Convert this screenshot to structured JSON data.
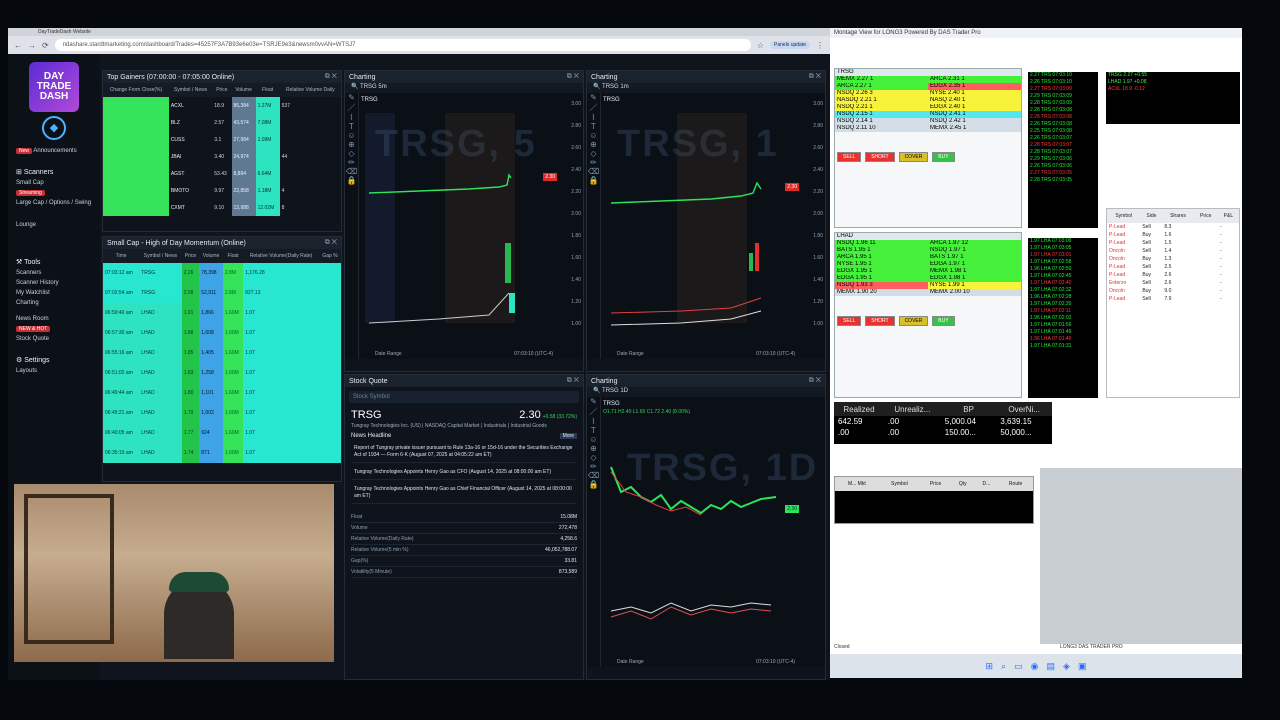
{
  "browser": {
    "url": "ndashare.stardtmarketing.com/dashboard/Trades=45257F3A7B93e6e03e=TSRJE9e3&newsm0vvAN=WTSJ7",
    "tab_title": "DayTradeDash Website",
    "ext_label": "Panels update"
  },
  "sidebar": {
    "logo_text": "DAY TRADE DASH",
    "announcements": "Announcements",
    "scanners_title": "Scanners",
    "items": [
      "Small Cap",
      "Large Cap / Options / Swing",
      "Lounge"
    ],
    "small_cap_badge": "Streaming",
    "tools_title": "Tools",
    "tools": [
      "Scanners",
      "Scanner History",
      "My Watchlist",
      "Charting",
      "News Room",
      "Stock Quote"
    ],
    "news_badge": "NEW & HOT",
    "settings": "Settings",
    "layouts": "Layouts"
  },
  "top_gainers": {
    "title": "Top Gainers (07:00:00 - 07:05:00 Online)",
    "headers": [
      "Change From Close(%)",
      "Symbol / News",
      "Price",
      "Volume",
      "Float",
      "Relative Volume Daily"
    ],
    "rows": [
      {
        "sym": "ACXL",
        "price": "18.9",
        "vol": "86,384",
        "float": "1.27M",
        "rel": "537"
      },
      {
        "sym": "BLZ",
        "price": "2.57",
        "vol": "43,574",
        "float": "7.08M",
        "rel": ""
      },
      {
        "sym": "CUSS",
        "price": "3.1",
        "vol": "27,984",
        "float": "1.09M",
        "rel": ""
      },
      {
        "sym": "JBAI",
        "price": "3.40",
        "vol": "24,974",
        "float": "",
        "rel": "44"
      },
      {
        "sym": "AGST",
        "price": "53.43",
        "vol": "8,894",
        "float": "6.64M",
        "rel": ""
      },
      {
        "sym": "BMOTO",
        "price": "9.97",
        "vol": "22,858",
        "float": "1.18M",
        "rel": "4"
      },
      {
        "sym": "CXMT",
        "price": "9.10",
        "vol": "13,988",
        "float": "12.02M",
        "rel": "8"
      }
    ]
  },
  "hod": {
    "title": "Small Cap - High of Day Momentum (Online)",
    "headers": [
      "Time",
      "Symbol / News",
      "Price",
      "Volume",
      "Float",
      "Relative Volume(Daily Rate)",
      "Gap %"
    ],
    "rows": [
      {
        "t": "07:03:12 am",
        "sym": "TRSG",
        "price": "2.26",
        "vol": "78,398",
        "float": "2.8M",
        "rel": "1,176.28"
      },
      {
        "t": "07:02:54 am",
        "sym": "TRSG",
        "price": "2.09",
        "vol": "52,911",
        "float": "2.8M",
        "rel": "827.13"
      },
      {
        "t": "06:59:40 am",
        "sym": "LHAD",
        "price": "1.91",
        "vol": "1,866",
        "float": "1.60M",
        "rel": "1.07"
      },
      {
        "t": "06:57:30 am",
        "sym": "LHAD",
        "price": "1.88",
        "vol": "1,608",
        "float": "1.60M",
        "rel": "1.07"
      },
      {
        "t": "06:55:16 am",
        "sym": "LHAD",
        "price": "1.85",
        "vol": "1,405",
        "float": "1.60M",
        "rel": "1.07"
      },
      {
        "t": "06:51:02 am",
        "sym": "LHAD",
        "price": "1.83",
        "vol": "1,258",
        "float": "1.60M",
        "rel": "1.07"
      },
      {
        "t": "06:49:44 am",
        "sym": "LHAD",
        "price": "1.80",
        "vol": "1,101",
        "float": "1.60M",
        "rel": "1.07"
      },
      {
        "t": "06:45:21 am",
        "sym": "LHAD",
        "price": "1.79",
        "vol": "1,002",
        "float": "1.60M",
        "rel": "1.07"
      },
      {
        "t": "06:40:05 am",
        "sym": "LHAD",
        "price": "1.77",
        "vol": "924",
        "float": "1.60M",
        "rel": "1.07"
      },
      {
        "t": "06:35:19 am",
        "sym": "LHAD",
        "price": "1.74",
        "vol": "871",
        "float": "1.60M",
        "rel": "1.07"
      }
    ]
  },
  "chart1": {
    "title": "Charting",
    "symbol": "TRSG",
    "watermark": "TRSG, 5",
    "interval": "5m",
    "range_label": "Date Range",
    "time": "07:03:10 (UTC-4)",
    "price_tag": "2.30",
    "prices": [
      "3.00",
      "2.80",
      "2.60",
      "2.40",
      "2.20",
      "2.00",
      "1.80",
      "1.60",
      "1.40",
      "1.20",
      "1.00"
    ]
  },
  "chart2": {
    "title": "Charting",
    "symbol": "TRSG",
    "watermark": "TRSG, 1",
    "interval": "1m",
    "range_label": "Date Range",
    "time": "07:03:10 (UTC-4)",
    "price_tag": "2.30",
    "prices": [
      "3.00",
      "2.80",
      "2.60",
      "2.40",
      "2.20",
      "2.00",
      "1.80",
      "1.60",
      "1.40",
      "1.20",
      "1.00"
    ]
  },
  "chart3": {
    "title": "Charting",
    "symbol": "TRSG",
    "watermark": "TRSG, 1D",
    "interval": "1D",
    "range_label": "Date Range",
    "time": "07:03:10 (UTC-4)",
    "price_tag": "2.30",
    "ohlc": "O1.71 H2.40 L1.65 C1.72 2.40 (8.00%)"
  },
  "quote": {
    "title": "Stock Quote",
    "search_placeholder": "Stock Symbol",
    "symbol": "TRSG",
    "price": "2.30",
    "change": "+0.58 (33.72%)",
    "company": "Tungray Technologies Inc. (US) | NASDAQ Capital Market | Industrials | Industrial Goods",
    "news_title": "News Headline",
    "news_badge": "More",
    "news": [
      "Report of Tungray private issuer pursuant to Rule 13a-16 or 15d-16 under the Securities Exchange Act of 1934 — Form 6-K (August 07, 2025 at 04:05:22 am ET)",
      "Tungray Technologies Appoints Henry Gao as CFO (August 14, 2025 at 08:00:00 am ET)",
      "Tungray Technologies Appoints Henry Gao as Chief Financial Officer (August 14, 2025 at 08:00:00 am ET)"
    ],
    "stats": [
      {
        "k": "Float",
        "v": "15.08M"
      },
      {
        "k": "Volume",
        "v": "272,478"
      },
      {
        "k": "Relative Volume(Daily Rate)",
        "v": "4,258.6"
      },
      {
        "k": "Relative Volume(5 min %)",
        "v": "46,052,788.07"
      },
      {
        "k": "Gap(%)",
        "v": "33.81"
      },
      {
        "k": "Volatility(5 Minute)",
        "v": "873,589"
      }
    ]
  },
  "level2_a": {
    "title": "Montage View for LONG3 Powered By DAS Trader Pro",
    "symbol": "TRSG",
    "bid_rows": [
      {
        "mm": "MEMX",
        "p": "2.27",
        "s": "1",
        "c": "g"
      },
      {
        "mm": "ARCA",
        "p": "2.27",
        "s": "1",
        "c": "g"
      },
      {
        "mm": "NSDQ",
        "p": "2.26",
        "s": "3",
        "c": "y"
      },
      {
        "mm": "NASDQ",
        "p": "2.21",
        "s": "1",
        "c": "y"
      },
      {
        "mm": "NSDQ",
        "p": "2.21",
        "s": "1",
        "c": "y"
      },
      {
        "mm": "NSDQ",
        "p": "2.15",
        "s": "1",
        "c": "c"
      },
      {
        "mm": "NSDQ",
        "p": "2.14",
        "s": "1",
        "c": "s"
      },
      {
        "mm": "NSDQ",
        "p": "2.11",
        "s": "10",
        "c": "s"
      }
    ],
    "ask_rows": [
      {
        "mm": "ARCA",
        "p": "2.31",
        "s": "1",
        "c": "g"
      },
      {
        "mm": "EDGX",
        "p": "2.35",
        "s": "1",
        "c": "r"
      },
      {
        "mm": "NYSE",
        "p": "2.40",
        "s": "1",
        "c": "y"
      },
      {
        "mm": "NASQ",
        "p": "2.40",
        "s": "1",
        "c": "y"
      },
      {
        "mm": "EDGX",
        "p": "2.40",
        "s": "1",
        "c": "y"
      },
      {
        "mm": "NSDQ",
        "p": "2.41",
        "s": "1",
        "c": "c"
      },
      {
        "mm": "NSDQ",
        "p": "2.42",
        "s": "1",
        "c": "s"
      },
      {
        "mm": "MEMX",
        "p": "2.45",
        "s": "1",
        "c": "s"
      }
    ]
  },
  "level2_b": {
    "symbol": "LHAD",
    "bid_rows": [
      {
        "mm": "NSDQ",
        "p": "1.96",
        "s": "11",
        "c": "g"
      },
      {
        "mm": "BATS",
        "p": "1.95",
        "s": "1",
        "c": "g"
      },
      {
        "mm": "ARCA",
        "p": "1.95",
        "s": "1",
        "c": "g"
      },
      {
        "mm": "NYSE",
        "p": "1.95",
        "s": "1",
        "c": "g"
      },
      {
        "mm": "EDGX",
        "p": "1.95",
        "s": "1",
        "c": "g"
      },
      {
        "mm": "EDGA",
        "p": "1.95",
        "s": "1",
        "c": "g"
      },
      {
        "mm": "NSDQ",
        "p": "1.93",
        "s": "3",
        "c": "r"
      },
      {
        "mm": "MEMX",
        "p": "1.90",
        "s": "20",
        "c": "s"
      }
    ],
    "ask_rows": [
      {
        "mm": "ARCA",
        "p": "1.97",
        "s": "12",
        "c": "g"
      },
      {
        "mm": "NSDQ",
        "p": "1.97",
        "s": "1",
        "c": "g"
      },
      {
        "mm": "BATS",
        "p": "1.97",
        "s": "1",
        "c": "g"
      },
      {
        "mm": "EDGA",
        "p": "1.97",
        "s": "1",
        "c": "g"
      },
      {
        "mm": "MEMX",
        "p": "1.98",
        "s": "1",
        "c": "g"
      },
      {
        "mm": "EDGX",
        "p": "1.98",
        "s": "1",
        "c": "g"
      },
      {
        "mm": "NYSE",
        "p": "1.99",
        "s": "1",
        "c": "y"
      },
      {
        "mm": "MEMX",
        "p": "2.00",
        "s": "10",
        "c": "s"
      }
    ]
  },
  "buttons": {
    "sell": "SELL",
    "short": "SHORT",
    "buy": "BUY",
    "cover": "COVER"
  },
  "timesales_a": [
    "2.27 TRS 07:03:10",
    "2.26 TRS 07:03:10",
    "2.27 TRS 07:03:09",
    "2.29 TRS 07:03:09",
    "2.28 TRS 07:03:09",
    "2.28 TRS 07:03:08",
    "2.28 TRS 07:03:08",
    "2.26 TRS 07:03:08",
    "2.25 TRS 07:03:08",
    "2.26 TRS 07:03:07",
    "2.28 TRS 07:03:07",
    "2.28 TRS 07:03:07",
    "2.29 TRS 07:03:06",
    "2.26 TRS 07:03:06",
    "2.27 TRS 07:03:05",
    "2.28 TRS 07:03:05"
  ],
  "timesales_b": [
    "1.97 LHA 07:03:09",
    "1.97 LHA 07:03:05",
    "1.97 LHA 07:03:01",
    "1.97 LHA 07:02:58",
    "1.96 LHA 07:02:50",
    "1.97 LHA 07:02:45",
    "1.97 LHA 07:02:40",
    "1.97 LHA 07:02:32",
    "1.96 LHA 07:02:28",
    "1.97 LHA 07:02:20",
    "1.97 LHA 07:02:11",
    "1.96 LHA 07:02:02",
    "1.97 LHA 07:01:56",
    "1.97 LHA 07:01:49",
    "1.96 LHA 07:01:40",
    "1.97 LHA 07:01:31"
  ],
  "positions": {
    "headers": [
      "Symbol",
      "Side",
      "Shares",
      "Price",
      "P&L"
    ],
    "rows": [
      [
        "P-Lead",
        "Sell",
        "8.3",
        "",
        "-"
      ],
      [
        "P-Lead",
        "Buy",
        "1.6",
        "",
        "-"
      ],
      [
        "P-Lead",
        "Sell",
        "1.5",
        "",
        "-"
      ],
      [
        "Oncoln",
        "Sell",
        "1.4",
        "",
        "-"
      ],
      [
        "Oncoln",
        "Buy",
        "1.3",
        "",
        "-"
      ],
      [
        "P-Lead",
        "Sell",
        "2.5",
        "",
        "-"
      ],
      [
        "P-Lead",
        "Buy",
        "2.6",
        "",
        "-"
      ],
      [
        "Enterzo",
        "Sell",
        "2.6",
        "",
        "-"
      ],
      [
        "Oncoln",
        "Buy",
        "9.0",
        "",
        "-"
      ],
      [
        "P-Lead",
        "Sell",
        "7.9",
        "",
        "-"
      ]
    ]
  },
  "account": {
    "headers": [
      "Realized",
      "Unrealiz...",
      "BP",
      "OverNi..."
    ],
    "rows": [
      [
        "642.59",
        ".00",
        "5,000.04",
        "3,639.15"
      ],
      [
        ".00",
        ".00",
        "150.00...",
        "50,000..."
      ]
    ]
  },
  "orders": {
    "headers": [
      "M... Mkt",
      "Symbol",
      "Price",
      "Qty",
      "D...",
      "Route"
    ]
  },
  "status": {
    "left": "Closed",
    "mid": "LONG3 DAS TRADER PRO"
  }
}
